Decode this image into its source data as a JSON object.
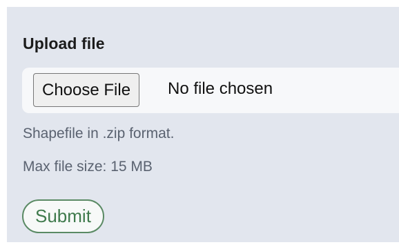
{
  "form": {
    "title": "Upload file",
    "file_input": {
      "button_label": "Choose File",
      "status_text": "No file chosen"
    },
    "hints": [
      "Shapefile in .zip format.",
      "Max file size: 15 MB"
    ],
    "submit_label": "Submit"
  },
  "colors": {
    "panel_background": "#e2e6ee",
    "submit_accent": "#3f7a4c",
    "hint_text": "#5a6270"
  }
}
